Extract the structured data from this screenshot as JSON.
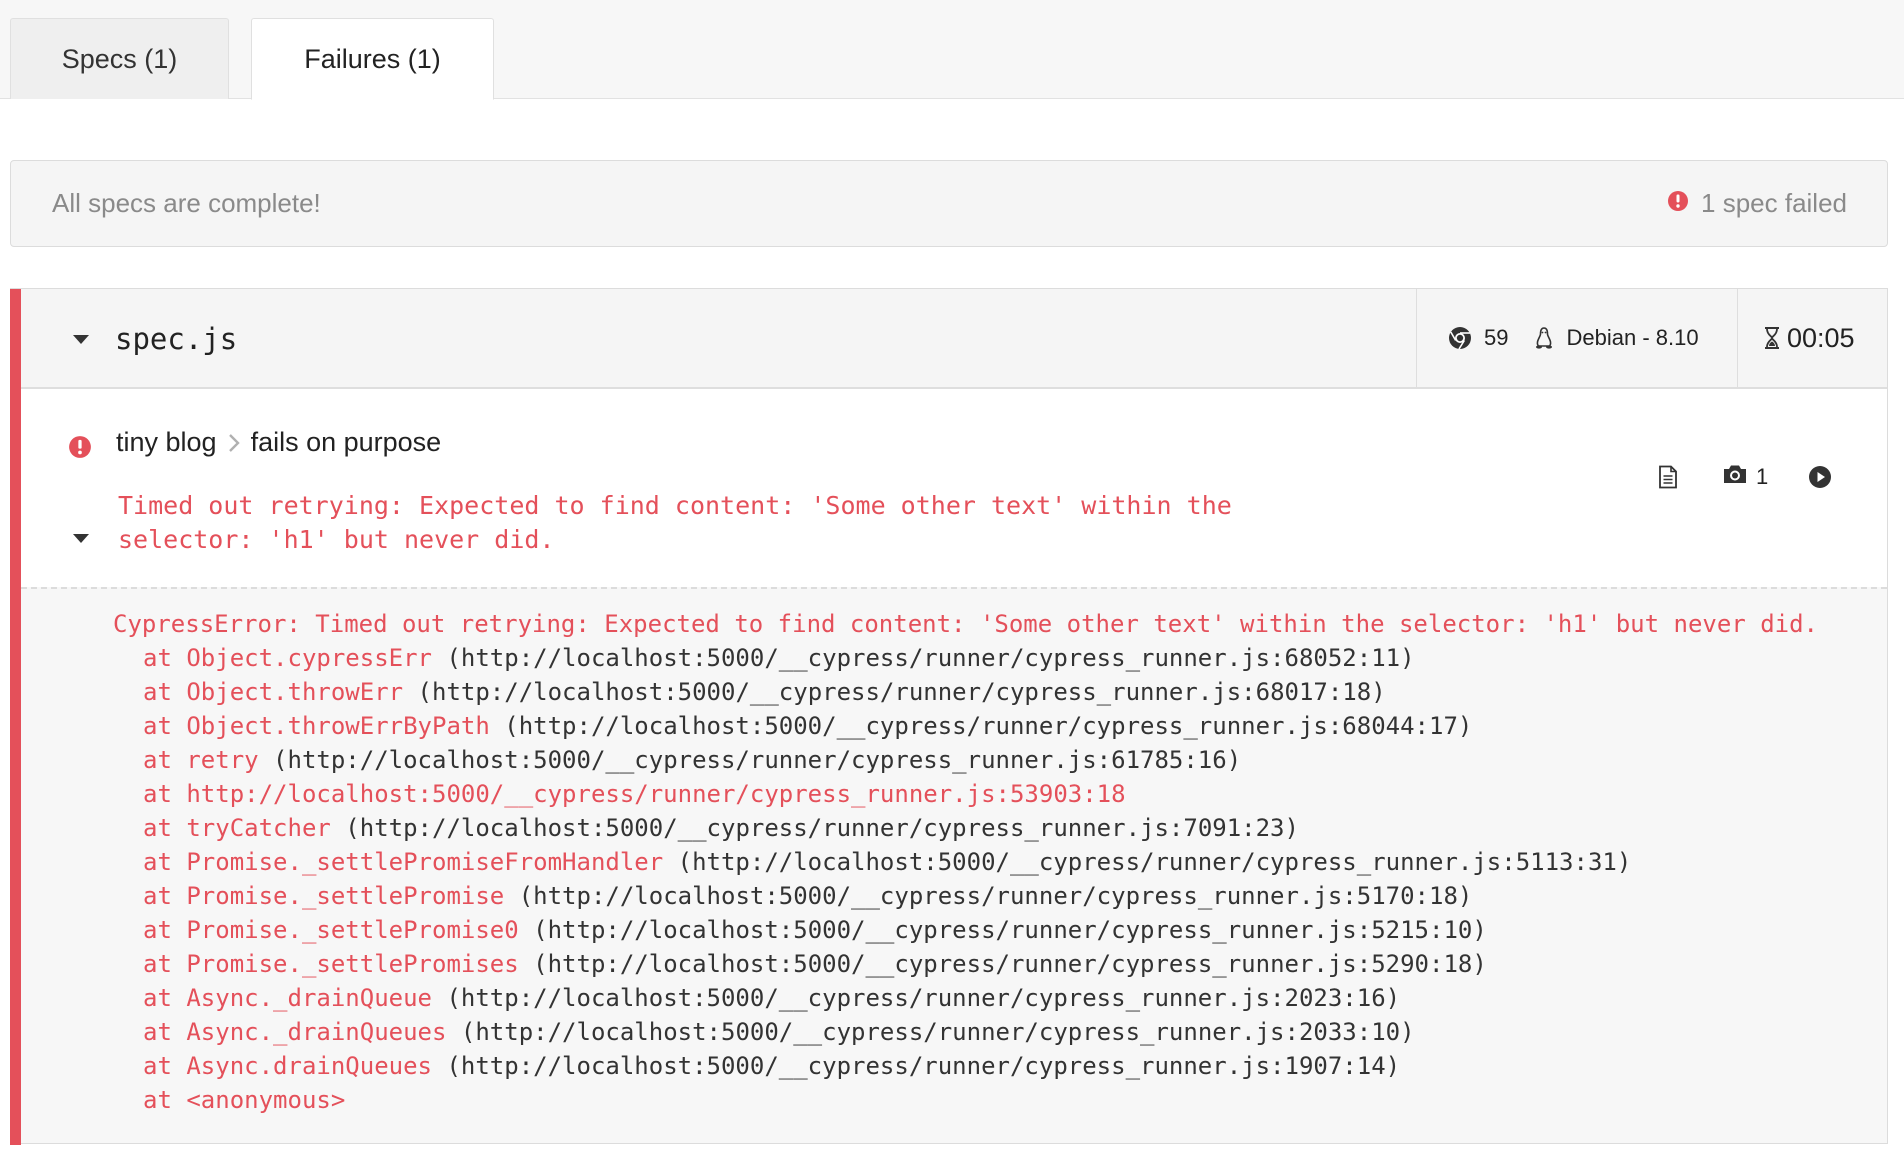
{
  "tabs": [
    {
      "label": "Specs (1)",
      "active": false
    },
    {
      "label": "Failures (1)",
      "active": true
    }
  ],
  "status": {
    "message": "All specs are complete!",
    "failed_summary": "1 spec failed"
  },
  "spec": {
    "name": "spec.js",
    "browser_version": "59",
    "os": "Debian - 8.10",
    "duration": "00:05"
  },
  "test": {
    "suite": "tiny blog",
    "title": "fails on purpose",
    "error_line1": "Timed out retrying: Expected to find content: 'Some other text' within the",
    "error_line2": "selector: 'h1' but never did.",
    "screenshot_count": "1"
  },
  "stack": {
    "header": "CypressError: Timed out retrying: Expected to find content: 'Some other text' within the selector: 'h1' but never did.",
    "frames": [
      {
        "at": "at ",
        "fn": "Object.cypressErr",
        "loc": " (http://localhost:5000/__cypress/runner/cypress_runner.js:68052:11)"
      },
      {
        "at": "at ",
        "fn": "Object.throwErr",
        "loc": " (http://localhost:5000/__cypress/runner/cypress_runner.js:68017:18)"
      },
      {
        "at": "at ",
        "fn": "Object.throwErrByPath",
        "loc": " (http://localhost:5000/__cypress/runner/cypress_runner.js:68044:17)"
      },
      {
        "at": "at ",
        "fn": "retry",
        "loc": " (http://localhost:5000/__cypress/runner/cypress_runner.js:61785:16)"
      },
      {
        "at": "at ",
        "fn": "http://localhost:5000/__cypress/runner/cypress_runner.js:53903:18",
        "loc": ""
      },
      {
        "at": "at ",
        "fn": "tryCatcher",
        "loc": " (http://localhost:5000/__cypress/runner/cypress_runner.js:7091:23)"
      },
      {
        "at": "at ",
        "fn": "Promise._settlePromiseFromHandler",
        "loc": " (http://localhost:5000/__cypress/runner/cypress_runner.js:5113:31)"
      },
      {
        "at": "at ",
        "fn": "Promise._settlePromise",
        "loc": " (http://localhost:5000/__cypress/runner/cypress_runner.js:5170:18)"
      },
      {
        "at": "at ",
        "fn": "Promise._settlePromise0",
        "loc": " (http://localhost:5000/__cypress/runner/cypress_runner.js:5215:10)"
      },
      {
        "at": "at ",
        "fn": "Promise._settlePromises",
        "loc": " (http://localhost:5000/__cypress/runner/cypress_runner.js:5290:18)"
      },
      {
        "at": "at ",
        "fn": "Async._drainQueue",
        "loc": " (http://localhost:5000/__cypress/runner/cypress_runner.js:2023:16)"
      },
      {
        "at": "at ",
        "fn": "Async._drainQueues",
        "loc": " (http://localhost:5000/__cypress/runner/cypress_runner.js:2033:10)"
      },
      {
        "at": "at ",
        "fn": "Async.drainQueues",
        "loc": " (http://localhost:5000/__cypress/runner/cypress_runner.js:1907:14)"
      },
      {
        "at": "at ",
        "fn": "<anonymous>",
        "loc": ""
      }
    ]
  },
  "colors": {
    "failure_red": "#e4505a",
    "panel_gray": "#f5f5f5",
    "muted_text": "#8a8a8a"
  },
  "icons": {
    "alert": "alert-circle-icon",
    "caret": "caret-down-icon",
    "browser": "chrome-icon",
    "os": "linux-icon",
    "duration": "hourglass-icon",
    "log": "document-icon",
    "screenshot": "camera-icon",
    "video": "play-circle-icon"
  }
}
